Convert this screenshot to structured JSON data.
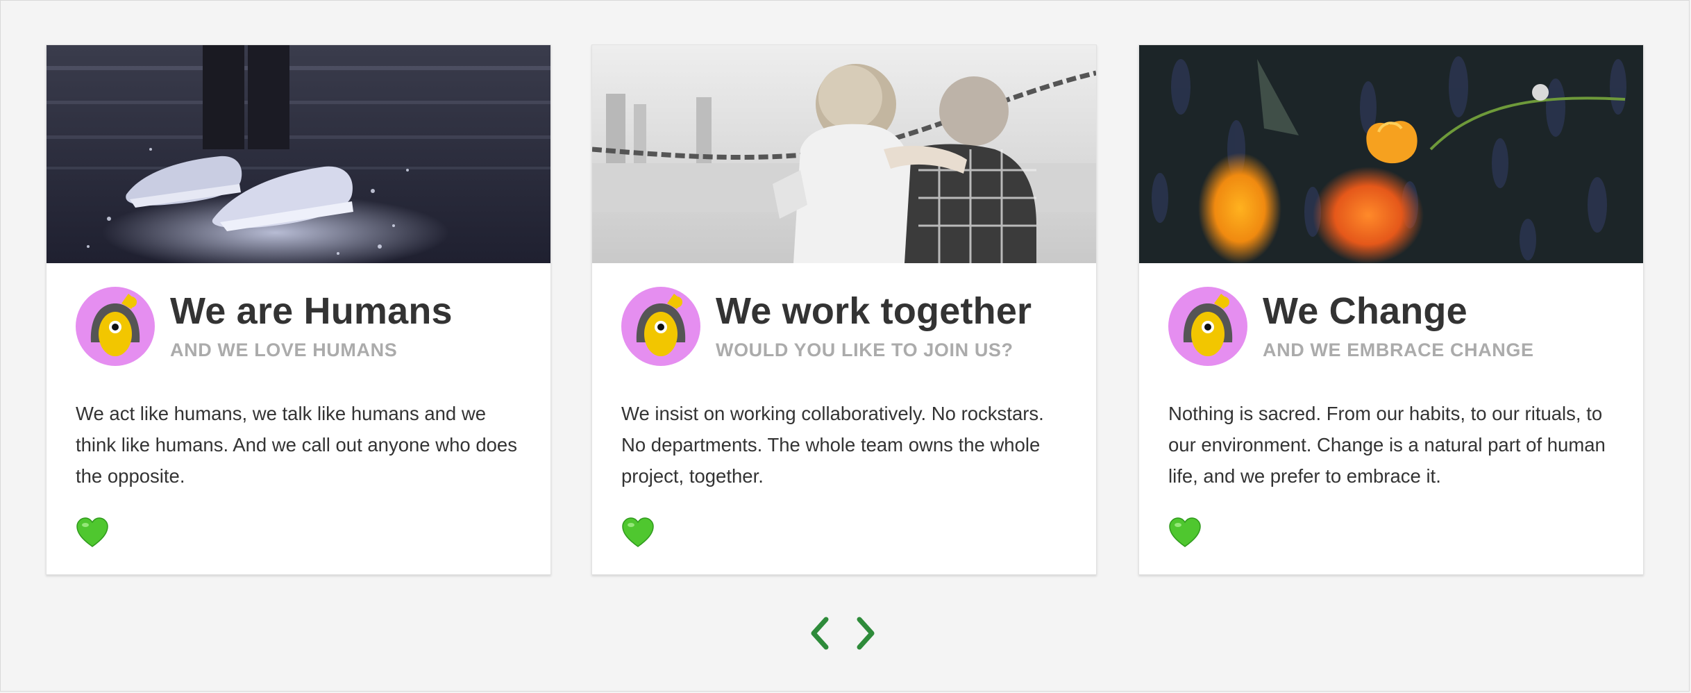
{
  "colors": {
    "page_background": "#f4f4f4",
    "card_background": "#ffffff",
    "title_text": "#333333",
    "subtitle_text": "#ababab",
    "accent_green": "#2e8b3a",
    "heart_green": "#4fc72f",
    "avatar_ring": "#e58ef0",
    "avatar_face": "#f2c600"
  },
  "cards": [
    {
      "image": "shoes-splashing-photo",
      "avatar_icon": "girl-avatar-icon",
      "title": "We are Humans",
      "subtitle": "AND WE LOVE HUMANS",
      "body": "We act like humans, we talk like humans and we think like humans. And we call out anyone who does the opposite.",
      "like_icon": "green-heart-icon"
    },
    {
      "image": "children-hugging-photo",
      "avatar_icon": "girl-avatar-icon",
      "title": "We work together",
      "subtitle": "WOULD YOU LIKE TO JOIN US?",
      "body": "We insist on working collaboratively. No rockstars. No departments. The whole team owns the whole project, together.",
      "like_icon": "green-heart-icon"
    },
    {
      "image": "orange-tulip-photo",
      "avatar_icon": "girl-avatar-icon",
      "title": "We Change",
      "subtitle": "AND WE EMBRACE CHANGE",
      "body": "Nothing is sacred. From our habits, to our rituals, to our environment. Change is a natural part of human life, and we prefer to embrace it.",
      "like_icon": "green-heart-icon"
    }
  ],
  "navigation": {
    "prev_icon": "chevron-left-icon",
    "next_icon": "chevron-right-icon"
  }
}
